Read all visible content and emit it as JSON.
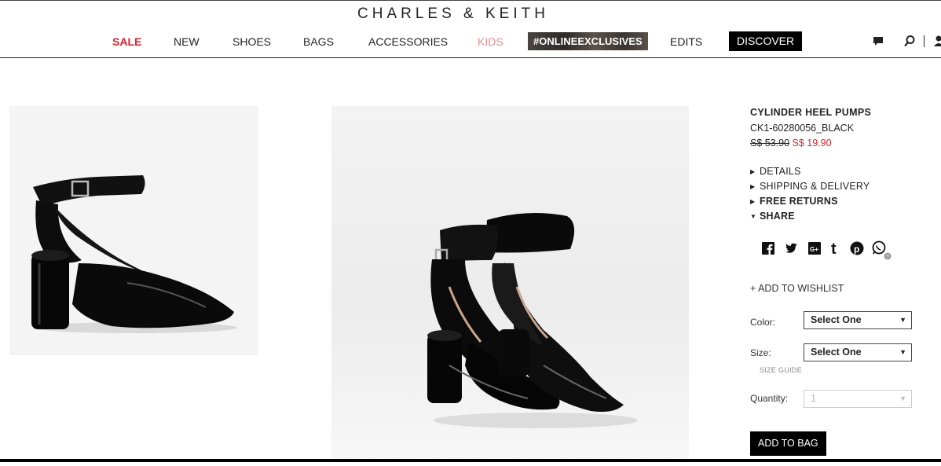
{
  "header": {
    "brand": "CHARLES & KEITH",
    "nav": {
      "sale": "SALE",
      "new": "NEW",
      "shoes": "SHOES",
      "bags": "BAGS",
      "accessories": "ACCESSORIES",
      "kids": "KIDS",
      "online_exclusives": "#ONLINEEXCLUSIVES",
      "edits": "EDITS",
      "discover": "DISCOVER"
    },
    "icons": [
      "chat-icon",
      "search-icon",
      "user-icon"
    ]
  },
  "product": {
    "name": "CYLINDER HEEL PUMPS",
    "sku": "CK1-60280056_BLACK",
    "old_price": "S$ 53.90",
    "new_price": "S$ 19.90",
    "accordion": {
      "details": "DETAILS",
      "shipping": "SHIPPING & DELIVERY",
      "returns": "FREE RETURNS",
      "share": "SHARE"
    },
    "share_icons": [
      "facebook-icon",
      "twitter-icon",
      "google-plus-icon",
      "tumblr-icon",
      "pinterest-icon",
      "whatsapp-icon"
    ],
    "wishlist": "+ ADD TO WISHLIST",
    "color_label": "Color:",
    "color_value": "Select One",
    "size_label": "Size:",
    "size_value": "Select One",
    "size_guide": "SIZE GUIDE",
    "quantity_label": "Quantity:",
    "quantity_value": "1",
    "add_to_bag": "ADD TO BAG"
  },
  "colors": {
    "sale": "#e0202a",
    "kids": "#f08a8a",
    "price": "#e0202a",
    "button": "#000000"
  }
}
